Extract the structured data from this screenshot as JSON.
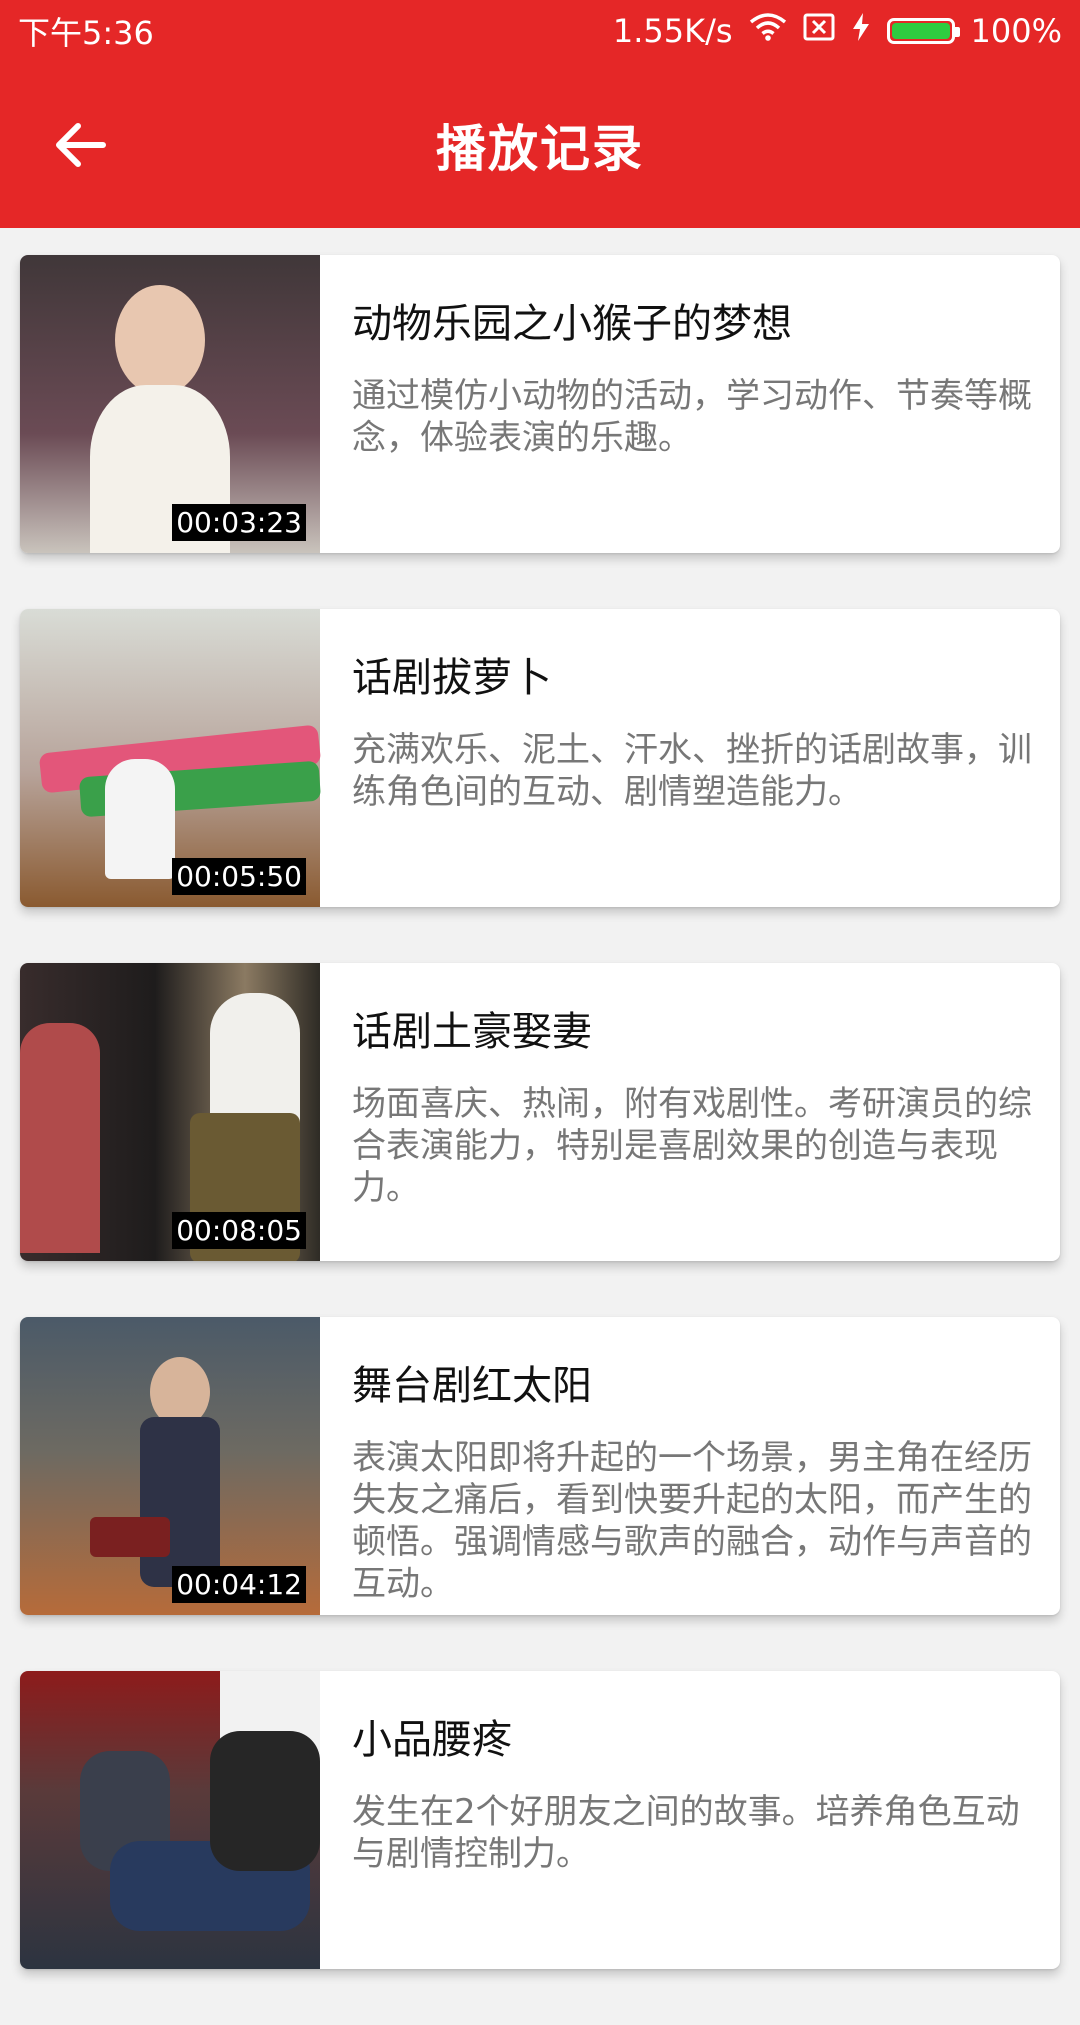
{
  "status_bar": {
    "time": "下午5:36",
    "network_speed": "1.55K/s",
    "battery": "100%",
    "icons": [
      "wifi-icon",
      "sim-off-icon",
      "charging-icon",
      "battery-icon"
    ]
  },
  "header": {
    "back_icon": "arrow-left-icon",
    "title": "播放记录"
  },
  "videos": [
    {
      "title": "动物乐园之小猴子的梦想",
      "description": "通过模仿小动物的活动，学习动作、节奏等概念，体验表演的乐趣。",
      "duration": "00:03:23"
    },
    {
      "title": "话剧拔萝卜",
      "description": "充满欢乐、泥土、汗水、挫折的话剧故事，训练角色间的互动、剧情塑造能力。",
      "duration": "00:05:50"
    },
    {
      "title": "话剧土豪娶妻",
      "description": "场面喜庆、热闹，附有戏剧性。考研演员的综合表演能力，特别是喜剧效果的创造与表现力。",
      "duration": "00:08:05"
    },
    {
      "title": "舞台剧红太阳",
      "description": "表演太阳即将升起的一个场景，男主角在经历失友之痛后，看到快要升起的太阳，而产生的顿悟。强调情感与歌声的融合，动作与声音的互动。",
      "duration": "00:04:12"
    },
    {
      "title": "小品腰疼",
      "description": "发生在2个好朋友之间的故事。培养角色互动与剧情控制力。",
      "duration": ""
    }
  ],
  "colors": {
    "primary": "#e52727",
    "battery_fill": "#2ecc40"
  }
}
